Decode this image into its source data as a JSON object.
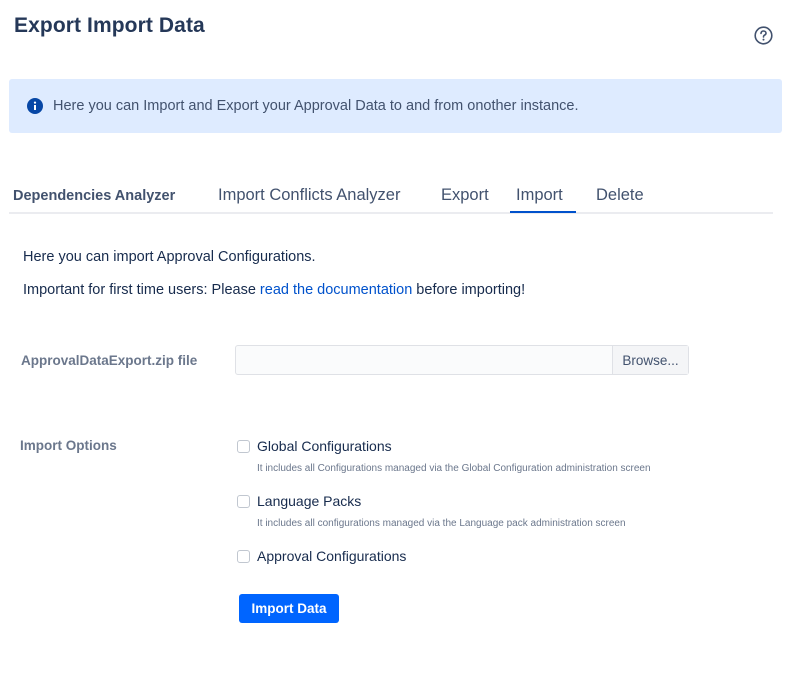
{
  "page": {
    "title": "Export Import Data",
    "help_icon": "help-circle-icon"
  },
  "banner": {
    "icon": "info-icon",
    "text": "Here you can Import and Export your Approval Data to and from onother instance."
  },
  "tabs": [
    {
      "label": "Dependencies Analyzer",
      "active": false
    },
    {
      "label": "Import Conflicts Analyzer",
      "active": false
    },
    {
      "label": "Export",
      "active": false
    },
    {
      "label": "Import",
      "active": true
    },
    {
      "label": "Delete",
      "active": false
    }
  ],
  "content": {
    "intro": "Here you can import Approval Configurations.",
    "important_prefix": "Important for first time users: Please ",
    "important_link": "read the documentation",
    "important_suffix": " before importing!"
  },
  "file_field": {
    "label": "ApprovalDataExport.zip file",
    "value": "",
    "browse_label": "Browse..."
  },
  "import_options": {
    "label": "Import Options",
    "options": [
      {
        "label": "Global Configurations",
        "checked": false,
        "description": "It includes all Configurations managed via the Global Configuration administration screen"
      },
      {
        "label": "Language Packs",
        "checked": false,
        "description": "It includes all configurations managed via the Language pack administration screen"
      },
      {
        "label": "Approval Configurations",
        "checked": false,
        "description": ""
      }
    ]
  },
  "actions": {
    "import_label": "Import Data"
  },
  "colors": {
    "accent": "#0052cc",
    "primary_button": "#0065ff",
    "banner_bg": "#deebff",
    "info_icon": "#0747a6"
  }
}
